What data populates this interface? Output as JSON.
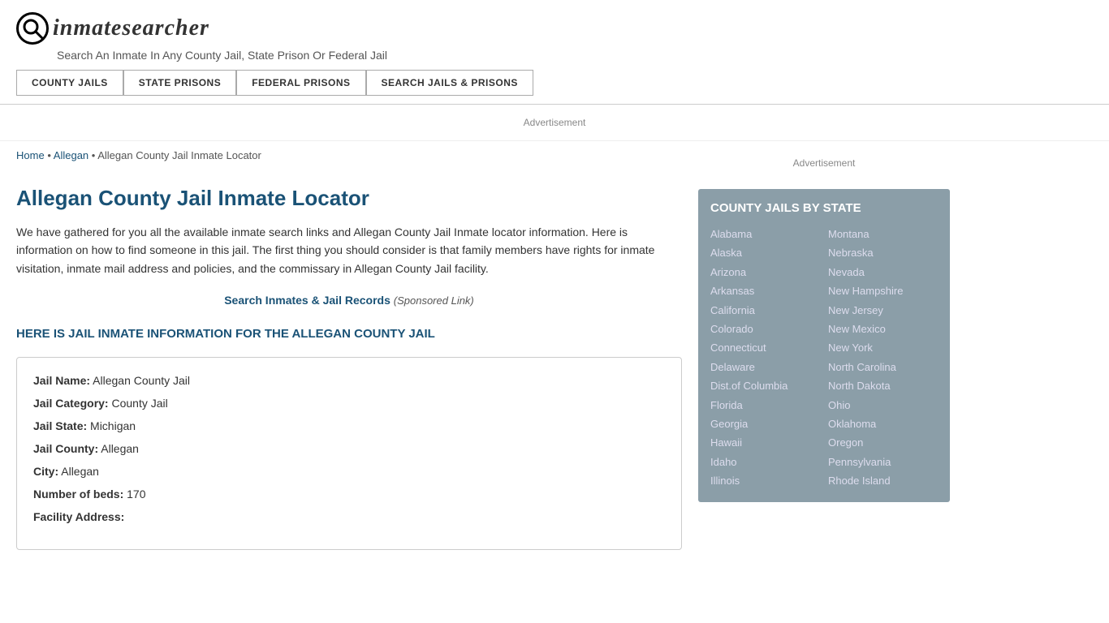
{
  "header": {
    "logo_icon": "🔍",
    "logo_text_pre": "inmate",
    "logo_text_post": "searcher",
    "tagline": "Search An Inmate In Any County Jail, State Prison Or Federal Jail"
  },
  "nav": {
    "buttons": [
      {
        "id": "county-jails",
        "label": "COUNTY JAILS"
      },
      {
        "id": "state-prisons",
        "label": "STATE PRISONS"
      },
      {
        "id": "federal-prisons",
        "label": "FEDERAL PRISONS"
      },
      {
        "id": "search-jails",
        "label": "SEARCH JAILS & PRISONS"
      }
    ]
  },
  "ad_banner": "Advertisement",
  "breadcrumb": {
    "home_label": "Home",
    "separator": "•",
    "allegan_label": "Allegan",
    "current": "Allegan County Jail Inmate Locator"
  },
  "page_title": "Allegan County Jail Inmate Locator",
  "description": "We have gathered for you all the available inmate search links and Allegan County Jail Inmate locator information. Here is information on how to find someone in this jail. The first thing you should consider is that family members have rights for inmate visitation, inmate mail address and policies, and the commissary in Allegan County Jail facility.",
  "search_link_text": "Search Inmates & Jail Records",
  "search_link_sponsored": "(Sponsored Link)",
  "jail_info_heading": "HERE IS JAIL INMATE INFORMATION FOR THE ALLEGAN COUNTY JAIL",
  "jail_details": {
    "name_label": "Jail Name:",
    "name_value": "Allegan County Jail",
    "category_label": "Jail Category:",
    "category_value": "County Jail",
    "state_label": "Jail State:",
    "state_value": "Michigan",
    "county_label": "Jail County:",
    "county_value": "Allegan",
    "city_label": "City:",
    "city_value": "Allegan",
    "beds_label": "Number of beds:",
    "beds_value": "170",
    "address_label": "Facility Address:"
  },
  "sidebar": {
    "ad_label": "Advertisement",
    "county_jails_title": "COUNTY JAILS BY STATE",
    "states_col1": [
      "Alabama",
      "Alaska",
      "Arizona",
      "Arkansas",
      "California",
      "Colorado",
      "Connecticut",
      "Delaware",
      "Dist.of Columbia",
      "Florida",
      "Georgia",
      "Hawaii",
      "Idaho",
      "Illinois"
    ],
    "states_col2": [
      "Montana",
      "Nebraska",
      "Nevada",
      "New Hampshire",
      "New Jersey",
      "New Mexico",
      "New York",
      "North Carolina",
      "North Dakota",
      "Ohio",
      "Oklahoma",
      "Oregon",
      "Pennsylvania",
      "Rhode Island"
    ]
  }
}
